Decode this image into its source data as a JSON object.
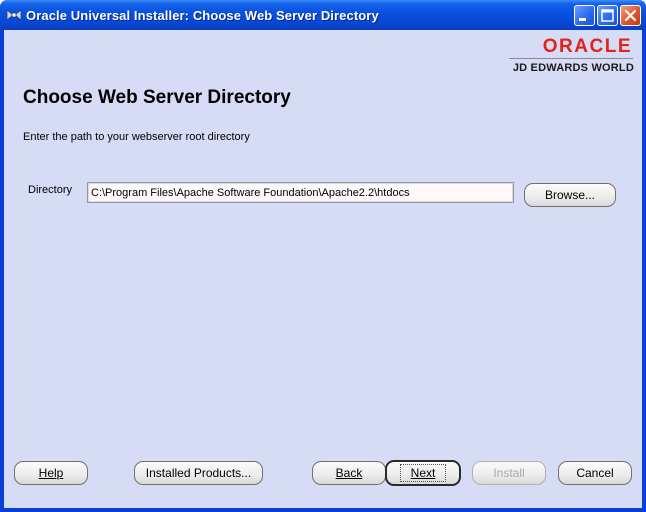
{
  "window": {
    "title": "Oracle Universal Installer: Choose Web Server Directory",
    "icon": "oracle-installer-icon"
  },
  "brand": {
    "oracle": "ORACLE",
    "product": "JD EDWARDS WORLD"
  },
  "page": {
    "title": "Choose Web Server Directory",
    "instruction": "Enter the path to your webserver root directory"
  },
  "directory": {
    "label": "Directory",
    "value": "C:\\Program Files\\Apache Software Foundation\\Apache2.2\\htdocs",
    "browse_label": "Browse..."
  },
  "footer": {
    "help": "Help",
    "installed_products": "Installed Products...",
    "back": "Back",
    "next": "Next",
    "install": "Install",
    "cancel": "Cancel"
  },
  "colors": {
    "oracle_red": "#e2231a",
    "client_bg": "#d6dcf5",
    "titlebar_blue": "#0a52e0"
  }
}
